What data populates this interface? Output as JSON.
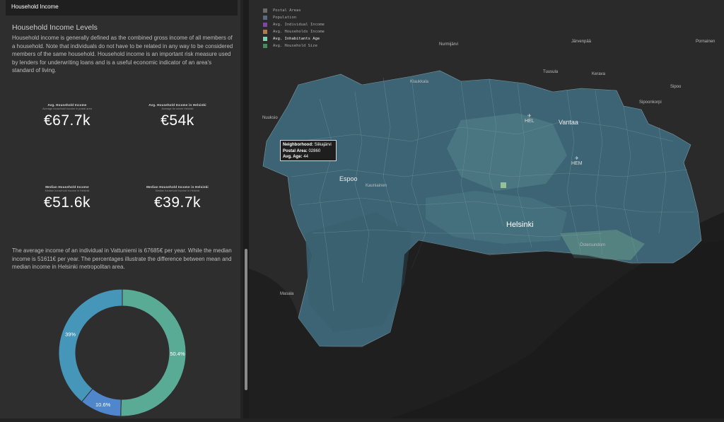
{
  "sidebar": {
    "header": "Household Income",
    "title": "Household Income Levels",
    "intro": "Household income is generally defined as the combined gross income of all members of a household. Note that individuals do not have to be related in any way to be considered members of the same household. Household income is an important risk measure used by lenders for underwriting loans and is a useful economic indicator of an area's standard of living.",
    "kpis": [
      {
        "label": "Avg. Household Income",
        "sub": "Average household income in postal area",
        "value": "€67.7k"
      },
      {
        "label": "Avg. Household Income in Helsinki",
        "sub": "Average for whole Helsinki",
        "value": "€54k"
      },
      {
        "label": "Median Household Income",
        "sub": "Median household income in Helsinki",
        "value": "€51.6k"
      },
      {
        "label": "Median Household Income in Helsinki",
        "sub": "Median household income in Helsinki",
        "value": "€39.7k"
      }
    ],
    "paragraph": "The average income of an individual in Vattuniemi is 67685€ per year. While the median income is 51611€ per year. The percentages illustrate the difference between mean and median income in Helsinki metropolitan area."
  },
  "chart_data": {
    "type": "pie",
    "hole": true,
    "slices": [
      {
        "label": "50.4%",
        "value": 50.4,
        "color": "#5aab96"
      },
      {
        "label": "10.6%",
        "value": 10.6,
        "color": "#4f86cc"
      },
      {
        "label": "39%",
        "value": 39,
        "color": "#4596b8"
      }
    ]
  },
  "map": {
    "legend": [
      {
        "label": "Postal Areas",
        "color": "#6b6b6b"
      },
      {
        "label": "Population",
        "color": "#5a6a80"
      },
      {
        "label": "Avg. Individual Income",
        "color": "#7a4aa0"
      },
      {
        "label": "Avg. Households Income",
        "color": "#b07a4a"
      },
      {
        "label": "Avg. Inhabitants Age",
        "color": "#7fd0b0"
      },
      {
        "label": "Avg. Household Size",
        "color": "#4a8a5a"
      }
    ],
    "tooltip": {
      "neighborhood_label": "Neighborhood:",
      "neighborhood": "Siikajärvi",
      "postal_label": "Postal Area:",
      "postal": "02860",
      "age_label": "Avg. Age:",
      "age": "44"
    },
    "places": {
      "nurmijarvi": "Nurmijärvi",
      "klaukkala": "Klaukkala",
      "tuusula": "Tuusula",
      "kerava": "Kerava",
      "jarvenpaa": "Järvenpää",
      "pornainen": "Pornainen",
      "sipoo": "Sipoo",
      "espoo": "Espoo",
      "kauniainen": "Kauniainen",
      "vantaa": "Vantaa",
      "helsinki": "Helsinki",
      "masala": "Masala",
      "nuuksio": "Nuuksio",
      "hel": "HEL",
      "hem": "HEM",
      "sipoonkorpi": "Sipoonkorpi",
      "ostersundom": "Östersundom"
    }
  }
}
